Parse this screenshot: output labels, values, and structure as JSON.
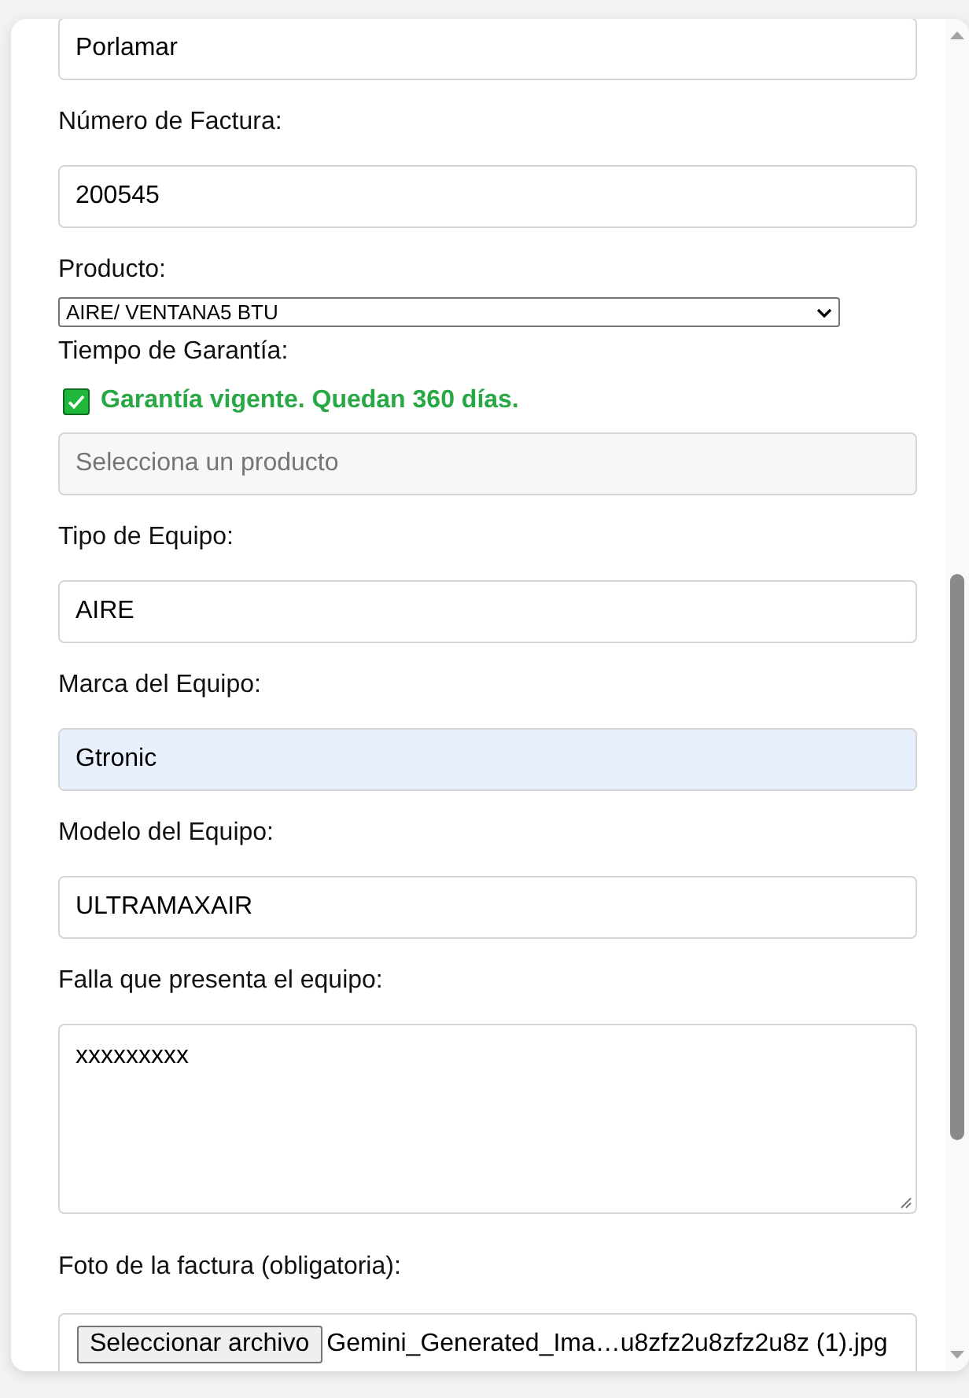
{
  "fields": [
    {
      "kind": "text",
      "value": "Porlamar",
      "autofilled": false
    },
    {
      "kind": "text",
      "label": "Número de Factura:",
      "value": "200545",
      "autofilled": false
    },
    {
      "kind": "select",
      "label": "Producto:",
      "value": "AIRE/ VENTANA5 BTU"
    },
    {
      "kind": "warranty",
      "label": "Tiempo de Garantía:",
      "status": {
        "text": "Garantía vigente. Quedan 360 días.",
        "valid": true
      },
      "input": {
        "placeholder": "Selecciona un producto",
        "disabled": true
      }
    },
    {
      "kind": "text",
      "label": "Tipo de Equipo:",
      "value": "AIRE",
      "autofilled": false
    },
    {
      "kind": "text",
      "label": "Marca del Equipo:",
      "value": "Gtronic",
      "autofilled": true
    },
    {
      "kind": "text",
      "label": "Modelo del Equipo:",
      "value": "ULTRAMAXAIR",
      "autofilled": false
    },
    {
      "kind": "textarea",
      "label": "Falla que presenta el equipo:",
      "value": "xxxxxxxxx"
    },
    {
      "kind": "file",
      "label": "Foto de la factura (obligatoria):",
      "button": "Seleccionar archivo",
      "file_name": "Gemini_Generated_Ima…u8zfz2u8zfz2u8z (1).jpg"
    }
  ]
}
